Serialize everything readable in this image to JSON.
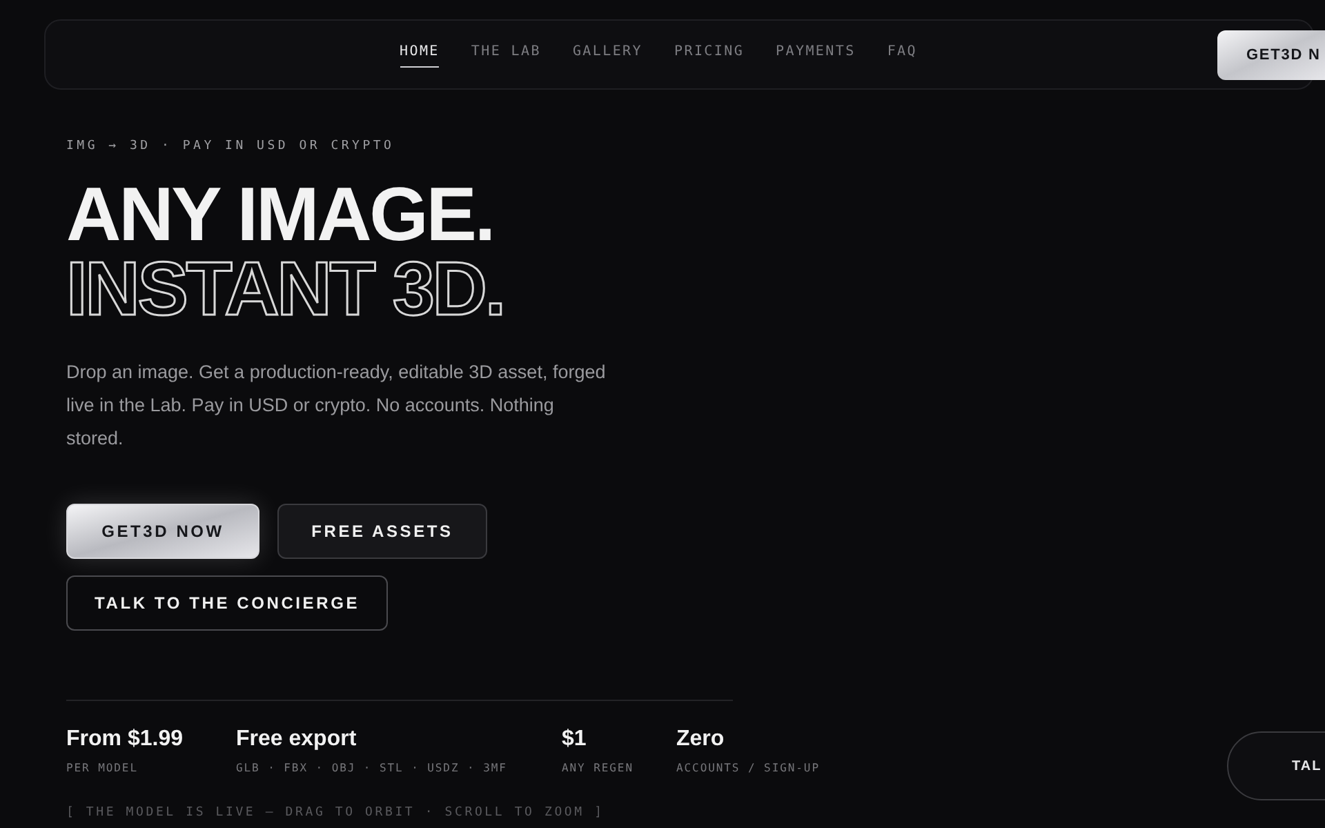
{
  "nav": {
    "items": [
      {
        "label": "HOME",
        "selected": true
      },
      {
        "label": "THE LAB",
        "selected": false
      },
      {
        "label": "GALLERY",
        "selected": false
      },
      {
        "label": "PRICING",
        "selected": false
      },
      {
        "label": "PAYMENTS",
        "selected": false
      },
      {
        "label": "FAQ",
        "selected": false
      }
    ],
    "cta": "GET3D N"
  },
  "hero": {
    "eyebrow": "IMG → 3D · PAY IN USD OR CRYPTO",
    "title_solid": "ANY IMAGE.",
    "title_outline": "INSTANT 3D.",
    "description": "Drop an image. Get a production-ready, editable 3D asset, forged live in the Lab. Pay in USD or crypto. No accounts. Nothing stored.",
    "buttons": [
      {
        "label": "GET3D NOW",
        "kind": "primary"
      },
      {
        "label": "FREE ASSETS",
        "kind": "secondary"
      },
      {
        "label": "TALK TO THE CONCIERGE",
        "kind": "outline"
      }
    ]
  },
  "stats": [
    {
      "value": "From $1.99",
      "caption": "PER MODEL"
    },
    {
      "value": "Free export",
      "caption": "GLB · FBX · OBJ · STL · USDZ · 3MF"
    },
    {
      "value": "$1",
      "caption": "ANY REGEN"
    },
    {
      "value": "Zero",
      "caption": "ACCOUNTS / SIGN-UP"
    }
  ],
  "hint": "[ THE MODEL IS LIVE — DRAG TO ORBIT · SCROLL TO ZOOM ]",
  "side_button": "TAL"
}
